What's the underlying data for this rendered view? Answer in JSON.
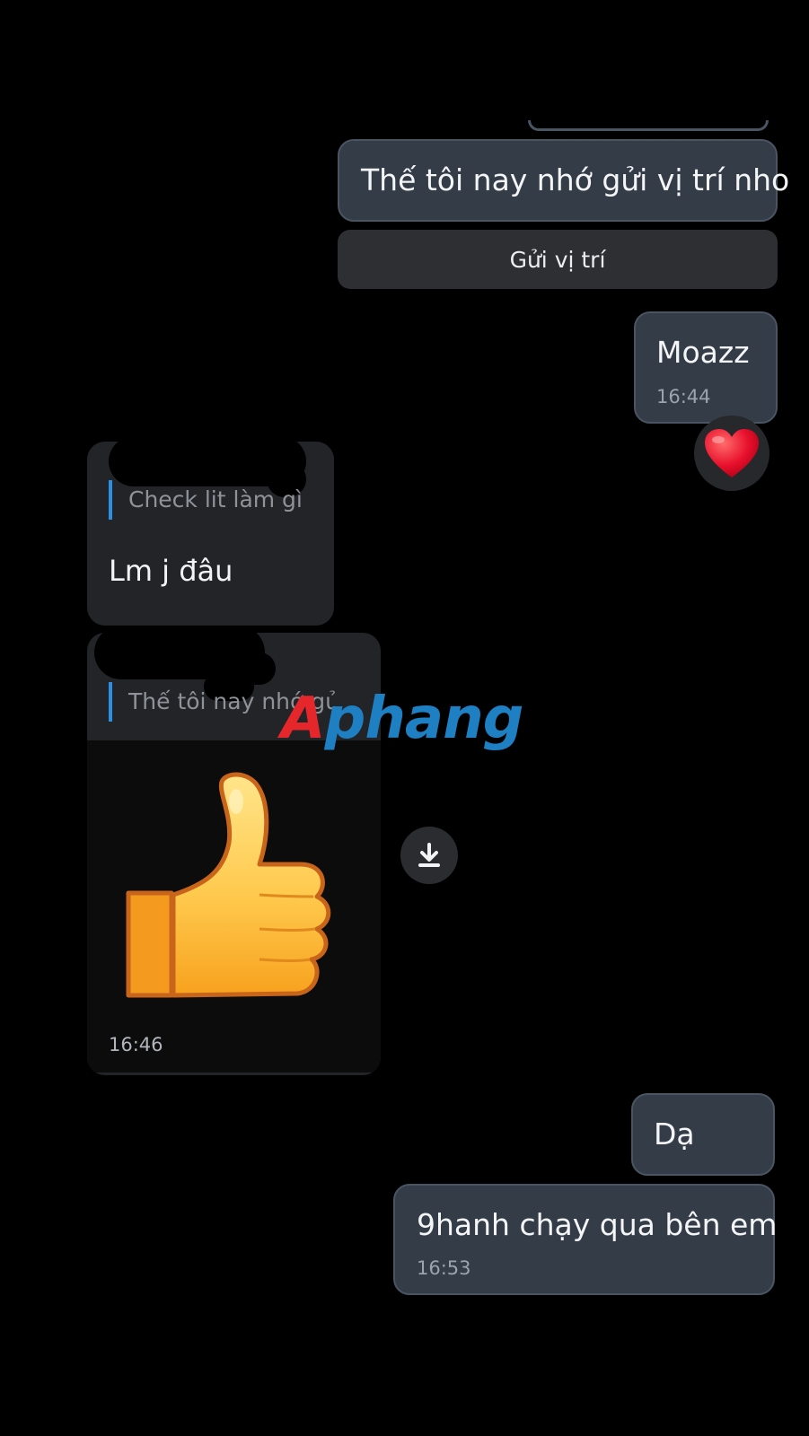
{
  "messages": {
    "outgoing_1": {
      "text": "Thế tôi nay nhớ gửi vị trí nho"
    },
    "action_button": {
      "label": "Gửi vị trí"
    },
    "outgoing_2": {
      "text": "Moazz",
      "time": "16:44",
      "reaction": "heart-emoji"
    },
    "incoming_1": {
      "quote": "Check lit làm gì",
      "text": "Lm j đâu"
    },
    "incoming_2": {
      "quote": "Thế tôi nay nhớ gửi vị trí nho",
      "sticker": "thumbs-up-sticker",
      "time": "16:46"
    },
    "outgoing_3": {
      "text": "Dạ"
    },
    "outgoing_4": {
      "text": "9hanh chạy qua bên em",
      "time": "16:53"
    }
  },
  "watermark": {
    "first": "A",
    "rest": "phang"
  },
  "colors": {
    "outgoing_bubble": "#343c48",
    "incoming_bubble": "#232427",
    "quote_bar": "#2b8fe6",
    "background": "#000000"
  }
}
